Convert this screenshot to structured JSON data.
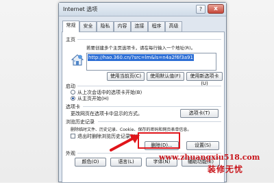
{
  "window": {
    "title": "Internet 选项",
    "help_label": "?",
    "close_label": "x"
  },
  "tabs": [
    "常规",
    "安全",
    "隐私",
    "内容",
    "连接",
    "程序",
    "高级"
  ],
  "home": {
    "section_label": "主页",
    "description": "若要创建多个主页选项卡，请在每行输入一个地址(R)。",
    "url": "http://hao.360.cn/?src=lm&ls=n4a2f6f3a91",
    "btn_current": "使用当前页(C)",
    "btn_default": "使用默认值(F)",
    "btn_blank": "使用新选项卡(U)"
  },
  "startup": {
    "section_label": "启动",
    "option_last": "从上次会话中的选项卡开始(B)",
    "option_home": "从主页开始(H)"
  },
  "tabs_section": {
    "section_label": "选项卡",
    "description": "更改网页在选项卡中显示的方式。",
    "btn": "选项卡(T)"
  },
  "history": {
    "section_label": "浏览历史记录",
    "description": "删除临时文件、历史记录、Cookie、保存的密码和网页表单信息。",
    "checkbox_label": "退出时删除浏览历史记录(W)",
    "btn_delete": "删除(D)...",
    "btn_settings": "设置(S)"
  },
  "appearance": {
    "section_label": "外观",
    "btn_colors": "颜色(O)",
    "btn_languages": "语言(L)",
    "btn_fonts": "字体(N)",
    "btn_accessibility": "辅助功能(E)"
  },
  "watermark": {
    "url": "www.zhuangxiu518.com",
    "text": "装修无忧"
  },
  "colors": {
    "highlight": "#e0141a",
    "accent": "#2c6ed5"
  }
}
